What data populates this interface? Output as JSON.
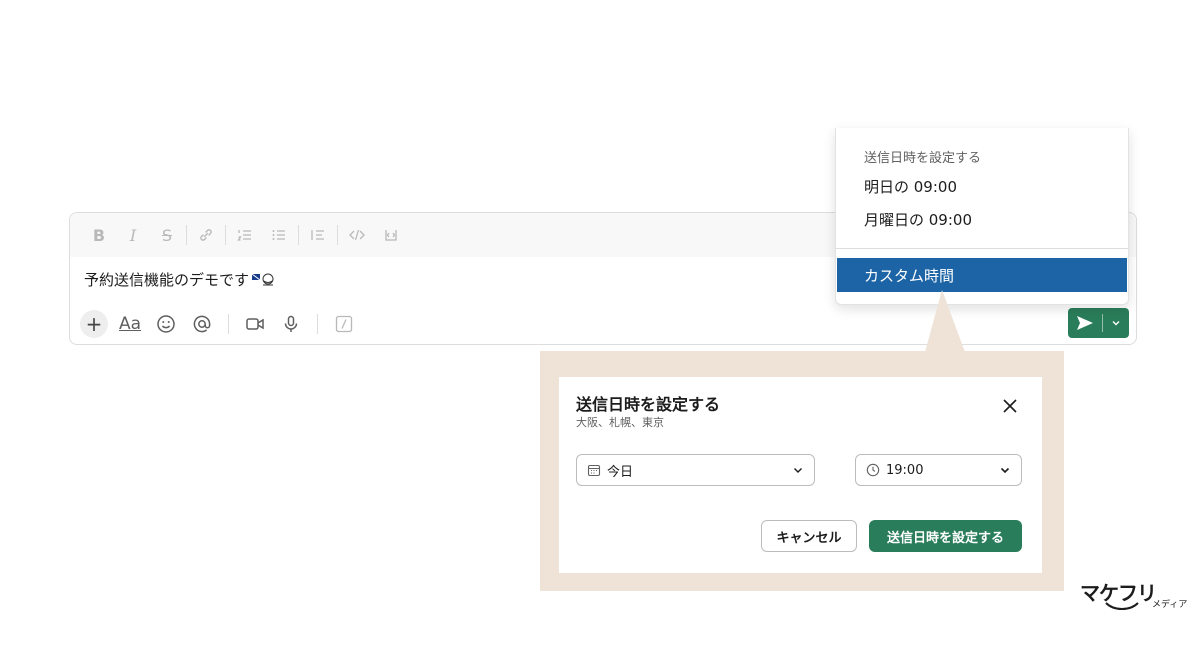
{
  "composer": {
    "message_text": "予約送信機能のデモです",
    "formatting_tools": [
      "B",
      "I",
      "S"
    ]
  },
  "bottom_tools": {
    "format_label": "Aa"
  },
  "schedule_menu": {
    "header": "送信日時を設定する",
    "items": [
      "明日の 09:00",
      "月曜日の 09:00"
    ],
    "custom_label": "カスタム時間"
  },
  "modal": {
    "title": "送信日時を設定する",
    "subtitle": "大阪、札幌、東京",
    "date_value": "今日",
    "time_value": "19:00",
    "cancel_label": "キャンセル",
    "submit_label": "送信日時を設定する"
  },
  "logo": {
    "main": "マケフリ",
    "sub": "メディア"
  },
  "colors": {
    "send_green": "#2a7d5a",
    "menu_highlight": "#1d64a6",
    "frame_beige": "#eee3d6"
  }
}
